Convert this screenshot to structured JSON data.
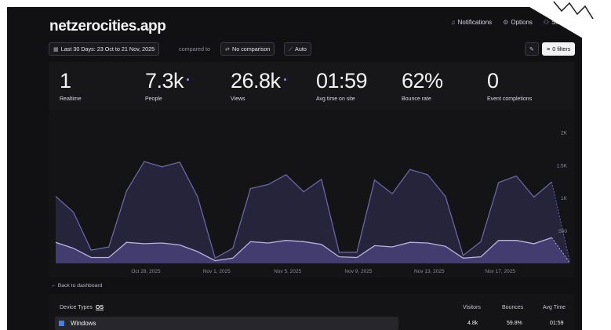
{
  "header": {
    "site": "netzerocities.app",
    "links": [
      {
        "icon": "bell-icon",
        "glyph": "♫",
        "label": "Notifications"
      },
      {
        "icon": "gear-icon",
        "glyph": "⚙",
        "label": "Options"
      },
      {
        "icon": "settings-icon",
        "glyph": "⚇",
        "label": "Settings"
      }
    ]
  },
  "toolbar": {
    "date_range": "Last 30 Days: 23 Oct to 21 Nov, 2025",
    "compared_to": "compared to",
    "comparison": "No comparison",
    "interval": "Auto",
    "filters": "0 filters"
  },
  "stats": [
    {
      "value": "1",
      "label": "Realtime",
      "dot": false
    },
    {
      "value": "7.3k",
      "label": "People",
      "dot": true
    },
    {
      "value": "26.8k",
      "label": "Views",
      "dot": true
    },
    {
      "value": "01:59",
      "label": "Avg time on site",
      "dot": false
    },
    {
      "value": "62%",
      "label": "Bounce rate",
      "dot": false
    },
    {
      "value": "0",
      "label": "Event completions",
      "dot": false
    }
  ],
  "chart_data": {
    "type": "area",
    "x": [
      "Oct 23",
      "Oct 24",
      "Oct 25",
      "Oct 26",
      "Oct 27",
      "Oct 28",
      "Oct 29",
      "Oct 30",
      "Oct 31",
      "Nov 1",
      "Nov 2",
      "Nov 3",
      "Nov 4",
      "Nov 5",
      "Nov 6",
      "Nov 7",
      "Nov 8",
      "Nov 9",
      "Nov 10",
      "Nov 11",
      "Nov 12",
      "Nov 13",
      "Nov 14",
      "Nov 15",
      "Nov 16",
      "Nov 17",
      "Nov 18",
      "Nov 19",
      "Nov 20",
      "Nov 21"
    ],
    "x_tick_labels": [
      "Oct 28, 2025",
      "Nov 1, 2025",
      "Nov 5, 2025",
      "Nov 9, 2025",
      "Nov 13, 2025",
      "Nov 17, 2025"
    ],
    "y_tick_labels": [
      "2K",
      "1.5K",
      "1K",
      "500"
    ],
    "ylim": [
      0,
      2100
    ],
    "series": [
      {
        "values": [
          1020,
          780,
          200,
          250,
          1100,
          1550,
          1470,
          1540,
          1020,
          80,
          230,
          1140,
          1200,
          1350,
          1090,
          1280,
          170,
          170,
          1270,
          1060,
          1430,
          1350,
          1020,
          120,
          330,
          1230,
          1330,
          1010,
          1240,
          50
        ]
      },
      {
        "values": [
          320,
          230,
          90,
          90,
          320,
          300,
          310,
          280,
          180,
          40,
          80,
          330,
          310,
          350,
          330,
          290,
          100,
          90,
          270,
          250,
          320,
          310,
          260,
          80,
          100,
          350,
          350,
          300,
          390,
          20
        ]
      }
    ]
  },
  "back_link": "Back to dashboard",
  "table": {
    "title": "Device Types",
    "tab": "OS",
    "columns": [
      "Visitors",
      "Bounces",
      "Avg Time"
    ],
    "rows": [
      {
        "name": "Windows",
        "icon": "windows-icon",
        "visitors": "4.8k",
        "bounces": "59.8%",
        "avg_time": "01:59"
      }
    ]
  }
}
